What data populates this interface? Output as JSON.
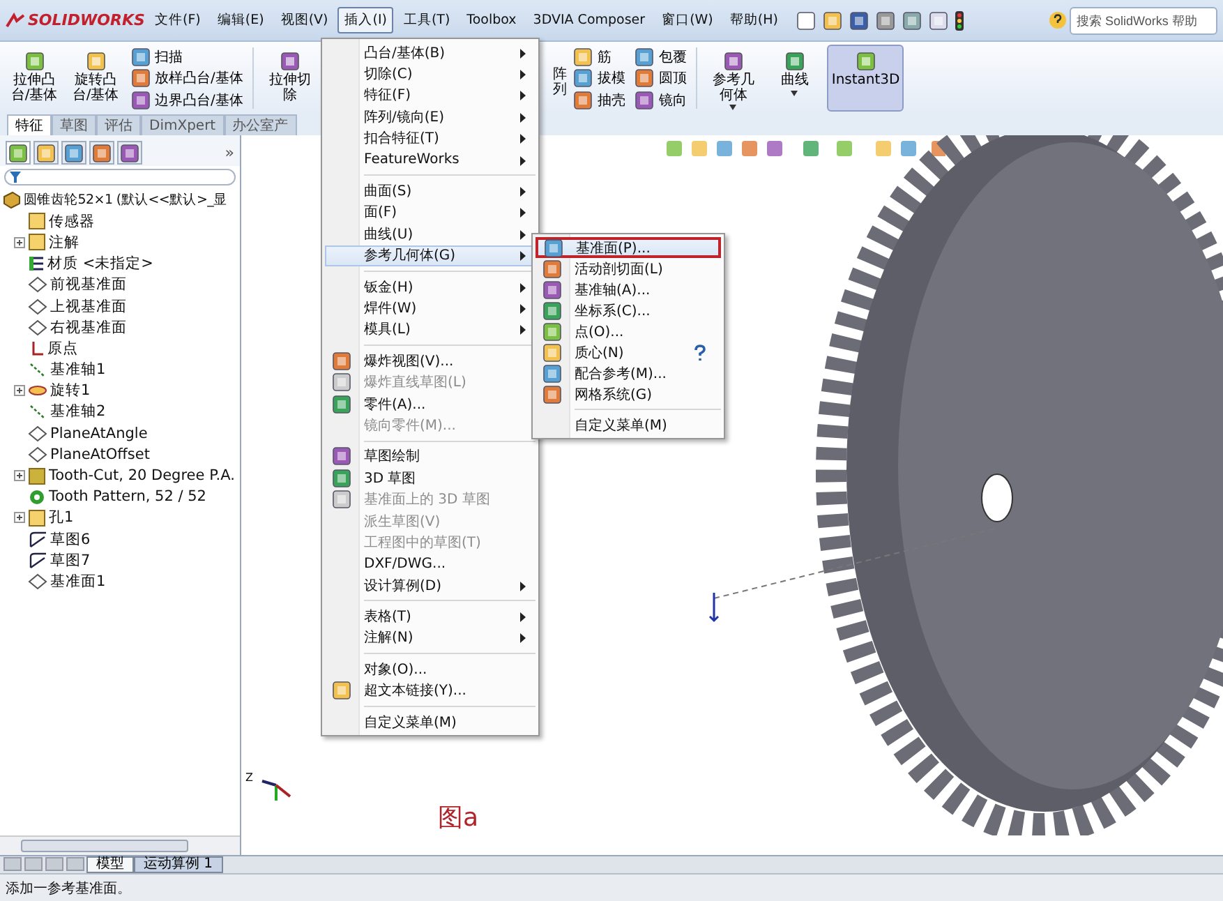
{
  "app": {
    "logo": "SOLIDWORKS"
  },
  "menubar": [
    {
      "label": "文件(F)",
      "selected": false
    },
    {
      "label": "编辑(E)",
      "selected": false
    },
    {
      "label": "视图(V)",
      "selected": false
    },
    {
      "label": "插入(I)",
      "selected": true
    },
    {
      "label": "工具(T)",
      "selected": false
    },
    {
      "label": "Toolbox",
      "selected": false
    },
    {
      "label": "3DVIA Composer",
      "selected": false
    },
    {
      "label": "窗口(W)",
      "selected": false
    },
    {
      "label": "帮助(H)",
      "selected": false
    }
  ],
  "search": {
    "placeholder": "搜索 SolidWorks 帮助"
  },
  "ribbon": [
    {
      "kind": "big",
      "label": "拉伸凸台/基体",
      "selected": false,
      "dropdown": false
    },
    {
      "kind": "big",
      "label": "旋转凸台/基体",
      "selected": false,
      "dropdown": false
    },
    {
      "kind": "stack",
      "items": [
        "扫描",
        "放样凸台/基体",
        "边界凸台/基体"
      ]
    },
    {
      "kind": "sep"
    },
    {
      "kind": "big",
      "label": "拉伸切除",
      "selected": false,
      "dropdown": false
    },
    {
      "kind": "gap"
    },
    {
      "kind": "fragment",
      "label": "阵列"
    },
    {
      "kind": "stack",
      "items": [
        "筋",
        "拔模",
        "抽壳"
      ]
    },
    {
      "kind": "stack",
      "items": [
        "包覆",
        "圆顶",
        "镜向"
      ]
    },
    {
      "kind": "sep"
    },
    {
      "kind": "big",
      "label": "参考几何体",
      "selected": false,
      "dropdown": true
    },
    {
      "kind": "big",
      "label": "曲线",
      "selected": false,
      "dropdown": true
    },
    {
      "kind": "big",
      "label": "Instant3D",
      "selected": true,
      "dropdown": false
    }
  ],
  "tabs": [
    {
      "label": "特征",
      "selected": true
    },
    {
      "label": "草图",
      "selected": false
    },
    {
      "label": "评估",
      "selected": false
    },
    {
      "label": "DimXpert",
      "selected": false
    },
    {
      "label": "办公室产",
      "selected": false
    }
  ],
  "panel": {
    "tabs": [
      {
        "selected": true
      },
      {
        "selected": false
      },
      {
        "selected": false
      },
      {
        "selected": false
      },
      {
        "selected": false
      }
    ],
    "more": "»",
    "tree": {
      "label": "圆锥齿轮52×1 (默认<<默认>_显",
      "kind": "part",
      "children": [
        {
          "label": "传感器",
          "kind": "sensor",
          "expandable": false
        },
        {
          "label": "注解",
          "kind": "annotation",
          "expandable": true
        },
        {
          "label": "材质 <未指定>",
          "kind": "material",
          "expandable": false
        },
        {
          "label": "前视基准面",
          "kind": "plane",
          "expandable": false
        },
        {
          "label": "上视基准面",
          "kind": "plane",
          "expandable": false
        },
        {
          "label": "右视基准面",
          "kind": "plane",
          "expandable": false
        },
        {
          "label": "原点",
          "kind": "origin",
          "expandable": false
        },
        {
          "label": "基准轴1",
          "kind": "axis",
          "expandable": false
        },
        {
          "label": "旋转1",
          "kind": "revolve",
          "expandable": true
        },
        {
          "label": "基准轴2",
          "kind": "axis",
          "expandable": false
        },
        {
          "label": "PlaneAtAngle",
          "kind": "plane",
          "expandable": false
        },
        {
          "label": "PlaneAtOffset",
          "kind": "plane",
          "expandable": false
        },
        {
          "label": "Tooth-Cut, 20 Degree P.A.",
          "kind": "cut",
          "expandable": true
        },
        {
          "label": "Tooth Pattern, 52 / 52",
          "kind": "pattern",
          "expandable": false
        },
        {
          "label": "孔1",
          "kind": "hole",
          "expandable": true
        },
        {
          "label": "草图6",
          "kind": "sketch",
          "expandable": false
        },
        {
          "label": "草图7",
          "kind": "sketch",
          "expandable": false
        },
        {
          "label": "基准面1",
          "kind": "plane",
          "expandable": false
        }
      ]
    }
  },
  "insert_menu": [
    [
      {
        "label": "凸台/基体(B)",
        "submenu": true,
        "disabled": false,
        "icon": false,
        "selected": false
      },
      {
        "label": "切除(C)",
        "submenu": true,
        "disabled": false,
        "icon": false,
        "selected": false
      },
      {
        "label": "特征(F)",
        "submenu": true,
        "disabled": false,
        "icon": false,
        "selected": false
      },
      {
        "label": "阵列/镜向(E)",
        "submenu": true,
        "disabled": false,
        "icon": false,
        "selected": false
      },
      {
        "label": "扣合特征(T)",
        "submenu": true,
        "disabled": false,
        "icon": false,
        "selected": false
      },
      {
        "label": "FeatureWorks",
        "submenu": true,
        "disabled": false,
        "icon": false,
        "selected": false
      }
    ],
    [
      {
        "label": "曲面(S)",
        "submenu": true,
        "disabled": false,
        "icon": false,
        "selected": false
      },
      {
        "label": "面(F)",
        "submenu": true,
        "disabled": false,
        "icon": false,
        "selected": false
      },
      {
        "label": "曲线(U)",
        "submenu": true,
        "disabled": false,
        "icon": false,
        "selected": false
      },
      {
        "label": "参考几何体(G)",
        "submenu": true,
        "disabled": false,
        "icon": false,
        "selected": true
      }
    ],
    [
      {
        "label": "钣金(H)",
        "submenu": true,
        "disabled": false,
        "icon": false,
        "selected": false
      },
      {
        "label": "焊件(W)",
        "submenu": true,
        "disabled": false,
        "icon": false,
        "selected": false
      },
      {
        "label": "模具(L)",
        "submenu": true,
        "disabled": false,
        "icon": false,
        "selected": false
      }
    ],
    [
      {
        "label": "爆炸视图(V)...",
        "submenu": false,
        "disabled": false,
        "icon": true,
        "selected": false
      },
      {
        "label": "爆炸直线草图(L)",
        "submenu": false,
        "disabled": true,
        "icon": true,
        "selected": false
      },
      {
        "label": "零件(A)...",
        "submenu": false,
        "disabled": false,
        "icon": true,
        "selected": false
      },
      {
        "label": "镜向零件(M)...",
        "submenu": false,
        "disabled": true,
        "icon": false,
        "selected": false
      }
    ],
    [
      {
        "label": "草图绘制",
        "submenu": false,
        "disabled": false,
        "icon": true,
        "selected": false
      },
      {
        "label": "3D 草图",
        "submenu": false,
        "disabled": false,
        "icon": true,
        "selected": false
      },
      {
        "label": "基准面上的 3D 草图",
        "submenu": false,
        "disabled": true,
        "icon": true,
        "selected": false
      },
      {
        "label": "派生草图(V)",
        "submenu": false,
        "disabled": true,
        "icon": false,
        "selected": false
      },
      {
        "label": "工程图中的草图(T)",
        "submenu": false,
        "disabled": true,
        "icon": false,
        "selected": false
      },
      {
        "label": "DXF/DWG...",
        "submenu": false,
        "disabled": false,
        "icon": false,
        "selected": false
      },
      {
        "label": "设计算例(D)",
        "submenu": true,
        "disabled": false,
        "icon": false,
        "selected": false
      }
    ],
    [
      {
        "label": "表格(T)",
        "submenu": true,
        "disabled": false,
        "icon": false,
        "selected": false
      },
      {
        "label": "注解(N)",
        "submenu": true,
        "disabled": false,
        "icon": false,
        "selected": false
      }
    ],
    [
      {
        "label": "对象(O)...",
        "submenu": false,
        "disabled": false,
        "icon": false,
        "selected": false
      },
      {
        "label": "超文本链接(Y)...",
        "submenu": false,
        "disabled": false,
        "icon": true,
        "selected": false
      }
    ],
    [
      {
        "label": "自定义菜单(M)",
        "submenu": false,
        "disabled": false,
        "icon": false,
        "selected": false
      }
    ]
  ],
  "reference_submenu": [
    [
      {
        "label": "基准面(P)...",
        "icon": true,
        "selected": true,
        "help": false
      },
      {
        "label": "活动剖切面(L)",
        "icon": true,
        "selected": false,
        "help": false
      },
      {
        "label": "基准轴(A)...",
        "icon": true,
        "selected": false,
        "help": false
      },
      {
        "label": "坐标系(C)...",
        "icon": true,
        "selected": false,
        "help": false
      },
      {
        "label": "点(O)...",
        "icon": true,
        "selected": false,
        "help": false
      },
      {
        "label": "质心(N)",
        "icon": true,
        "selected": false,
        "help": true
      },
      {
        "label": "配合参考(M)...",
        "icon": true,
        "selected": false,
        "help": false
      },
      {
        "label": "网格系统(G)",
        "icon": true,
        "selected": false,
        "help": false
      }
    ],
    [
      {
        "label": "自定义菜单(M)",
        "icon": false,
        "selected": false,
        "help": false
      }
    ]
  ],
  "viewport": {
    "caption": "图a",
    "triad_label": "Z"
  },
  "bottom_tabs": [
    {
      "label": "模型",
      "selected": false
    },
    {
      "label": "运动算例 1",
      "selected": true
    }
  ],
  "status_bar": {
    "text": "添加一参考基准面。"
  }
}
